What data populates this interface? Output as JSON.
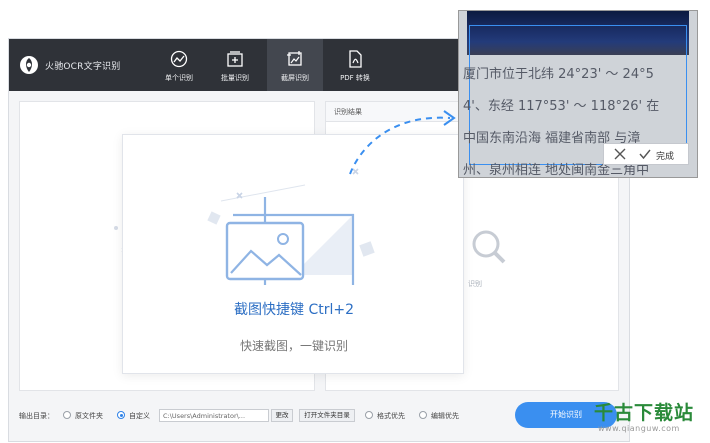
{
  "app": {
    "name": "火驰OCR文字识别",
    "toolbar": [
      {
        "label": "单个识别",
        "icon": "single-recognize-icon"
      },
      {
        "label": "批量识别",
        "icon": "batch-recognize-icon"
      },
      {
        "label": "截屏识别",
        "icon": "screenshot-recognize-icon",
        "active": true
      },
      {
        "label": "PDF 转换",
        "icon": "pdf-convert-icon"
      }
    ]
  },
  "result_panel": {
    "title": "识别结果",
    "placeholder_label": "识别"
  },
  "bottom": {
    "output_label": "输出目录：",
    "option_original": "原文件夹",
    "option_custom": "自定义",
    "path_value": "C:\\Users\\Administrator\\...",
    "change_button": "更改",
    "open_folder_button": "打开文件夹目录",
    "format_priority": "格式优先",
    "edit_priority": "编辑优先",
    "start_button": "开始识别"
  },
  "card": {
    "title": "截图快捷键 Ctrl+2",
    "subtitle": "快速截图，一键识别"
  },
  "preview": {
    "lines": [
      "厦门市位于北纬 24°23' ～ 24°5",
      "4'、东经 117°53' ～ 118°26' 在",
      "中国东南沿海  福建省南部  与漳",
      "州、泉州相连  地处闽南金三角中"
    ],
    "done_label": "完成"
  },
  "watermark": {
    "main": "千古下载站",
    "url": "www.qianguw.com"
  },
  "colors": {
    "accent": "#3a8ff0",
    "titlebar": "#2f3238",
    "card_title": "#2d6fc4"
  }
}
